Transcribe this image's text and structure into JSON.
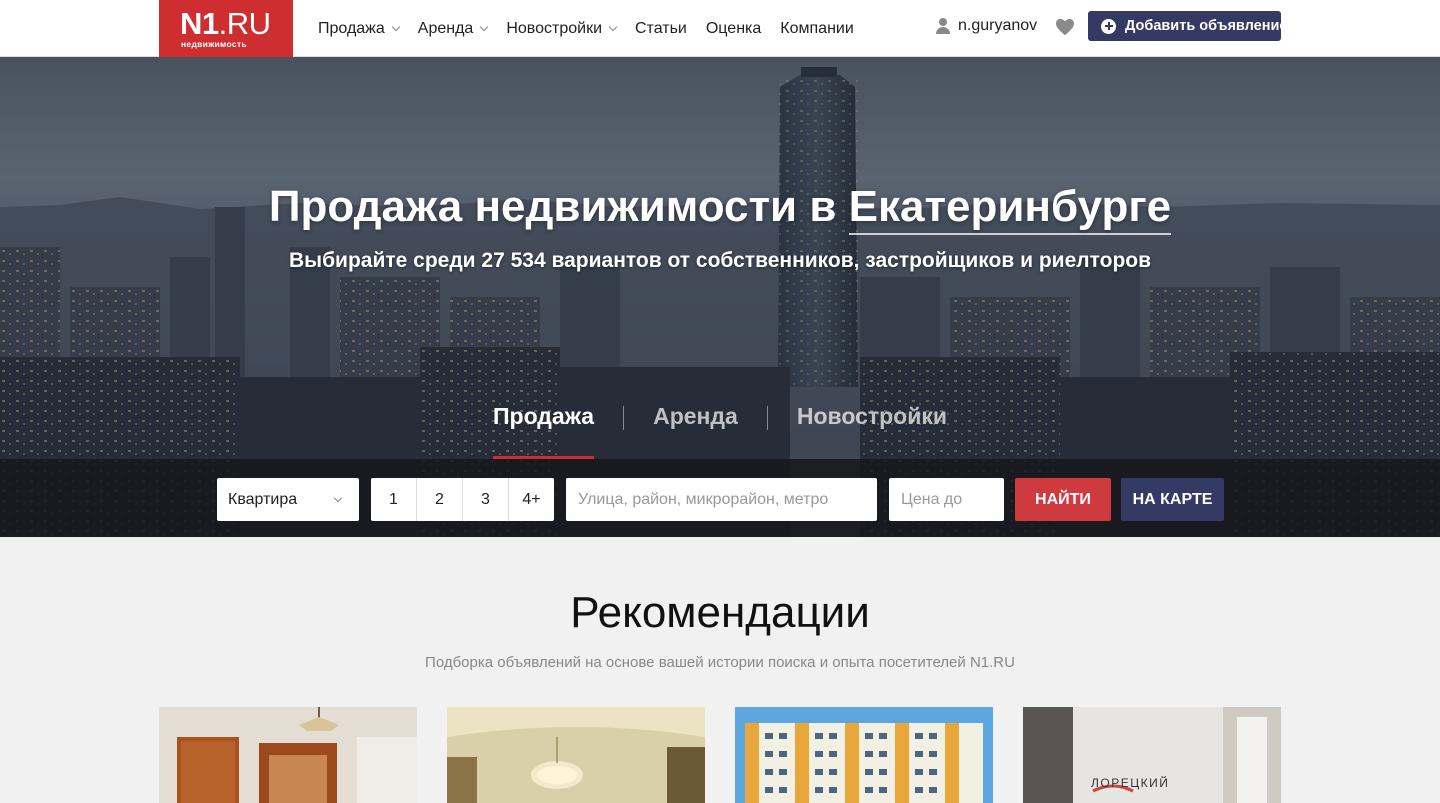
{
  "logo": {
    "main_bold": "N1",
    "main_light": ".RU",
    "sub": "недвижимость"
  },
  "nav": [
    {
      "label": "Продажа",
      "dropdown": true
    },
    {
      "label": "Аренда",
      "dropdown": true
    },
    {
      "label": "Новостройки",
      "dropdown": true
    },
    {
      "label": "Статьи",
      "dropdown": false
    },
    {
      "label": "Оценка",
      "dropdown": false
    },
    {
      "label": "Компании",
      "dropdown": false
    }
  ],
  "user": {
    "name": "n.guryanov",
    "icon": "user-icon"
  },
  "favorites": {
    "icon": "heart-icon"
  },
  "add_button": {
    "label": "Добавить объявление",
    "icon": "plus-circle-icon"
  },
  "hero": {
    "title_prefix": "Продажа недвижимости в",
    "city": "Екатеринбурге",
    "subtitle": "Выбирайте среди 27 534 вариантов от собственников, застройщиков и риелторов"
  },
  "tabs": [
    {
      "label": "Продажа",
      "active": true
    },
    {
      "label": "Аренда",
      "active": false
    },
    {
      "label": "Новостройки",
      "active": false
    }
  ],
  "search": {
    "type_value": "Квартира",
    "rooms": [
      "1",
      "2",
      "3",
      "4+"
    ],
    "street_placeholder": "Улица, район, микрорайон, метро",
    "price_placeholder": "Цена до",
    "find_label": "НАЙТИ",
    "map_label": "НА КАРТЕ"
  },
  "recommendations": {
    "title": "Рекомендации",
    "subtitle": "Подборка объявлений на основе вашей истории поиска и опыта посетителей N1.RU",
    "card_sign_text": "ЛОРЕЦКИЙ"
  },
  "colors": {
    "brand_red": "#cf2e31",
    "navy": "#343a63"
  }
}
